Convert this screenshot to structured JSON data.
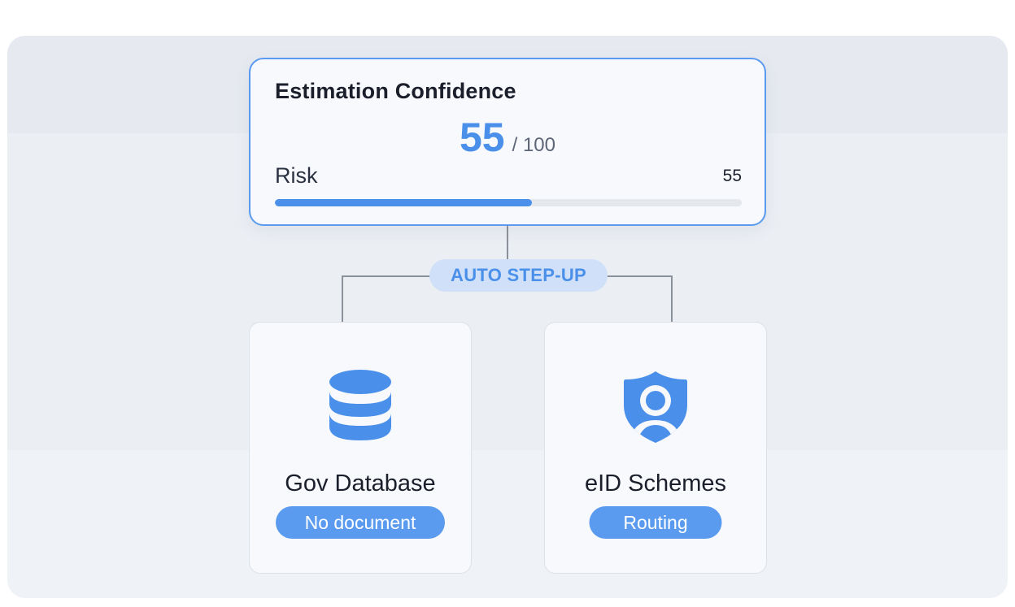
{
  "confidence_card": {
    "title": "Estimation Confidence",
    "score": "55",
    "score_max": "/ 100",
    "risk_label": "Risk",
    "risk_value": "55",
    "risk_fraction": 0.55
  },
  "step_up_badge": {
    "label": "AUTO STEP-UP"
  },
  "methods": [
    {
      "title": "Gov Database",
      "status": "No document",
      "icon": "database-icon"
    },
    {
      "title": "eID Schemes",
      "status": "Routing",
      "icon": "shield-user-icon"
    }
  ],
  "colors": {
    "accent": "#4a90ea",
    "card_border": "#5a9bef",
    "badge_bg": "#cfe0f8",
    "connector": "#8b919b"
  }
}
